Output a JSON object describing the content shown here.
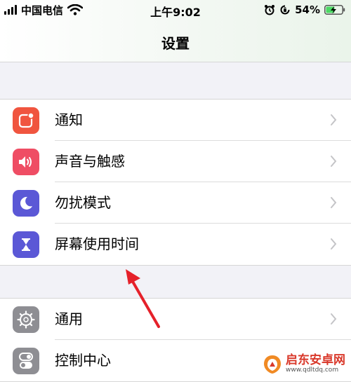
{
  "status_bar": {
    "carrier": "中国电信",
    "time": "上午9:02",
    "battery": "54%",
    "battery_level": 0.54,
    "icons": [
      "signal-icon",
      "wifi-icon",
      "alarm-icon",
      "rotation-lock-icon",
      "battery-charging-icon"
    ]
  },
  "header": {
    "title": "设置"
  },
  "groups": [
    {
      "items": [
        {
          "label": "通知",
          "icon": "notifications-icon",
          "color": "#f0553f"
        },
        {
          "label": "声音与触感",
          "icon": "sounds-icon",
          "color": "#ef4d64"
        },
        {
          "label": "勿扰模式",
          "icon": "do-not-disturb-icon",
          "color": "#5b58d6"
        },
        {
          "label": "屏幕使用时间",
          "icon": "screen-time-icon",
          "color": "#5b58d6"
        }
      ]
    },
    {
      "items": [
        {
          "label": "通用",
          "icon": "gear-icon",
          "color": "#8e8e93"
        },
        {
          "label": "控制中心",
          "icon": "toggles-icon",
          "color": "#8e8e93"
        }
      ]
    }
  ],
  "annotation": {
    "type": "arrow",
    "color": "#e5212a",
    "target": "屏幕使用时间"
  },
  "watermark": {
    "title": "启东安卓网",
    "url": "www.qdltdq.com"
  }
}
